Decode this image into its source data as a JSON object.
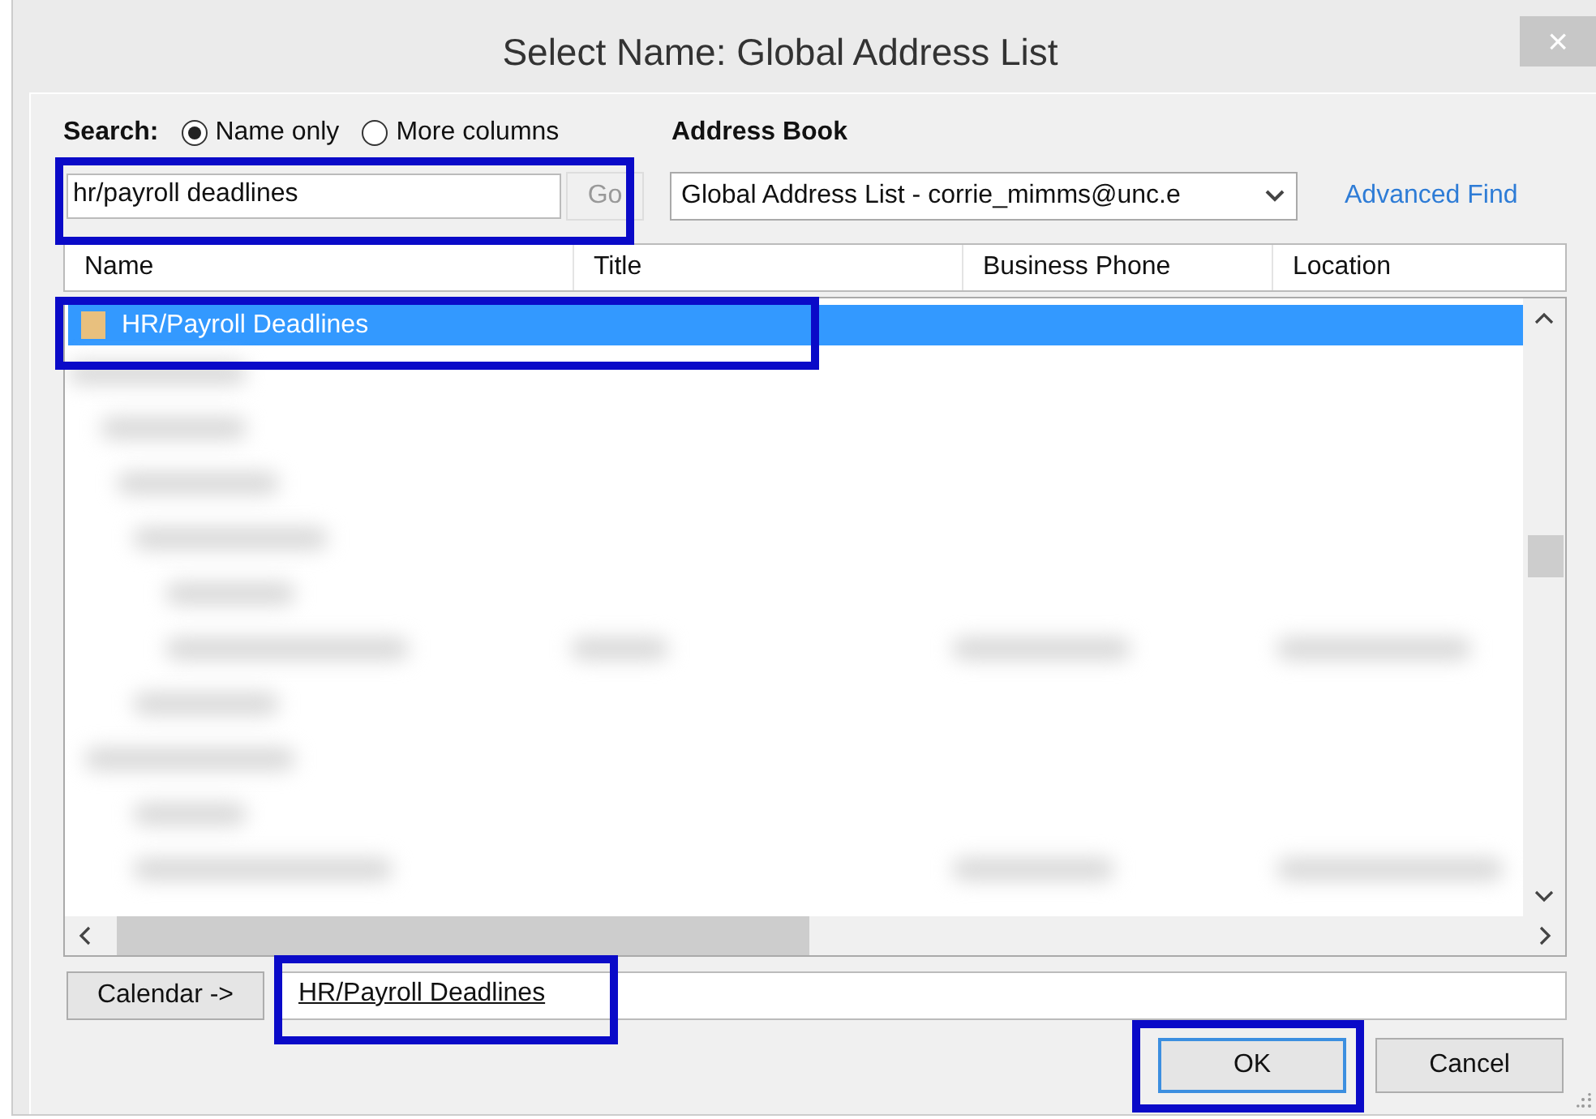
{
  "window": {
    "title": "Select Name: Global Address List",
    "close": "×"
  },
  "search": {
    "label": "Search:",
    "options": [
      {
        "label": "Name only",
        "selected": true
      },
      {
        "label": "More columns",
        "selected": false
      }
    ],
    "value": "hr/payroll deadlines",
    "go": "Go",
    "go_disabled": true
  },
  "address_book": {
    "label": "Address Book",
    "value": "Global Address List - corrie_mimms@unc.e",
    "advanced_find": "Advanced Find"
  },
  "table": {
    "columns": [
      "Name",
      "Title",
      "Business Phone",
      "Location"
    ],
    "rows": [
      {
        "name": "HR/Payroll Deadlines",
        "selected": true
      }
    ]
  },
  "recipient": {
    "button": "Calendar ->",
    "value": "HR/Payroll Deadlines"
  },
  "buttons": [
    {
      "label": "OK",
      "default": true
    },
    {
      "label": "Cancel",
      "default": false
    }
  ]
}
